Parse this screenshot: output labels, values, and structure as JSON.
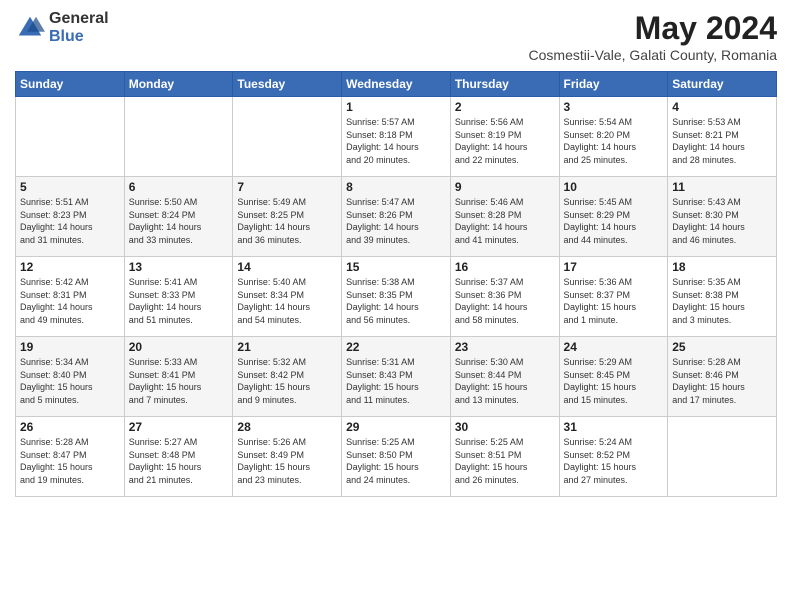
{
  "logo": {
    "general": "General",
    "blue": "Blue"
  },
  "header": {
    "month": "May 2024",
    "location": "Cosmestii-Vale, Galati County, Romania"
  },
  "days_of_week": [
    "Sunday",
    "Monday",
    "Tuesday",
    "Wednesday",
    "Thursday",
    "Friday",
    "Saturday"
  ],
  "weeks": [
    [
      {
        "day": "",
        "info": ""
      },
      {
        "day": "",
        "info": ""
      },
      {
        "day": "",
        "info": ""
      },
      {
        "day": "1",
        "info": "Sunrise: 5:57 AM\nSunset: 8:18 PM\nDaylight: 14 hours\nand 20 minutes."
      },
      {
        "day": "2",
        "info": "Sunrise: 5:56 AM\nSunset: 8:19 PM\nDaylight: 14 hours\nand 22 minutes."
      },
      {
        "day": "3",
        "info": "Sunrise: 5:54 AM\nSunset: 8:20 PM\nDaylight: 14 hours\nand 25 minutes."
      },
      {
        "day": "4",
        "info": "Sunrise: 5:53 AM\nSunset: 8:21 PM\nDaylight: 14 hours\nand 28 minutes."
      }
    ],
    [
      {
        "day": "5",
        "info": "Sunrise: 5:51 AM\nSunset: 8:23 PM\nDaylight: 14 hours\nand 31 minutes."
      },
      {
        "day": "6",
        "info": "Sunrise: 5:50 AM\nSunset: 8:24 PM\nDaylight: 14 hours\nand 33 minutes."
      },
      {
        "day": "7",
        "info": "Sunrise: 5:49 AM\nSunset: 8:25 PM\nDaylight: 14 hours\nand 36 minutes."
      },
      {
        "day": "8",
        "info": "Sunrise: 5:47 AM\nSunset: 8:26 PM\nDaylight: 14 hours\nand 39 minutes."
      },
      {
        "day": "9",
        "info": "Sunrise: 5:46 AM\nSunset: 8:28 PM\nDaylight: 14 hours\nand 41 minutes."
      },
      {
        "day": "10",
        "info": "Sunrise: 5:45 AM\nSunset: 8:29 PM\nDaylight: 14 hours\nand 44 minutes."
      },
      {
        "day": "11",
        "info": "Sunrise: 5:43 AM\nSunset: 8:30 PM\nDaylight: 14 hours\nand 46 minutes."
      }
    ],
    [
      {
        "day": "12",
        "info": "Sunrise: 5:42 AM\nSunset: 8:31 PM\nDaylight: 14 hours\nand 49 minutes."
      },
      {
        "day": "13",
        "info": "Sunrise: 5:41 AM\nSunset: 8:33 PM\nDaylight: 14 hours\nand 51 minutes."
      },
      {
        "day": "14",
        "info": "Sunrise: 5:40 AM\nSunset: 8:34 PM\nDaylight: 14 hours\nand 54 minutes."
      },
      {
        "day": "15",
        "info": "Sunrise: 5:38 AM\nSunset: 8:35 PM\nDaylight: 14 hours\nand 56 minutes."
      },
      {
        "day": "16",
        "info": "Sunrise: 5:37 AM\nSunset: 8:36 PM\nDaylight: 14 hours\nand 58 minutes."
      },
      {
        "day": "17",
        "info": "Sunrise: 5:36 AM\nSunset: 8:37 PM\nDaylight: 15 hours\nand 1 minute."
      },
      {
        "day": "18",
        "info": "Sunrise: 5:35 AM\nSunset: 8:38 PM\nDaylight: 15 hours\nand 3 minutes."
      }
    ],
    [
      {
        "day": "19",
        "info": "Sunrise: 5:34 AM\nSunset: 8:40 PM\nDaylight: 15 hours\nand 5 minutes."
      },
      {
        "day": "20",
        "info": "Sunrise: 5:33 AM\nSunset: 8:41 PM\nDaylight: 15 hours\nand 7 minutes."
      },
      {
        "day": "21",
        "info": "Sunrise: 5:32 AM\nSunset: 8:42 PM\nDaylight: 15 hours\nand 9 minutes."
      },
      {
        "day": "22",
        "info": "Sunrise: 5:31 AM\nSunset: 8:43 PM\nDaylight: 15 hours\nand 11 minutes."
      },
      {
        "day": "23",
        "info": "Sunrise: 5:30 AM\nSunset: 8:44 PM\nDaylight: 15 hours\nand 13 minutes."
      },
      {
        "day": "24",
        "info": "Sunrise: 5:29 AM\nSunset: 8:45 PM\nDaylight: 15 hours\nand 15 minutes."
      },
      {
        "day": "25",
        "info": "Sunrise: 5:28 AM\nSunset: 8:46 PM\nDaylight: 15 hours\nand 17 minutes."
      }
    ],
    [
      {
        "day": "26",
        "info": "Sunrise: 5:28 AM\nSunset: 8:47 PM\nDaylight: 15 hours\nand 19 minutes."
      },
      {
        "day": "27",
        "info": "Sunrise: 5:27 AM\nSunset: 8:48 PM\nDaylight: 15 hours\nand 21 minutes."
      },
      {
        "day": "28",
        "info": "Sunrise: 5:26 AM\nSunset: 8:49 PM\nDaylight: 15 hours\nand 23 minutes."
      },
      {
        "day": "29",
        "info": "Sunrise: 5:25 AM\nSunset: 8:50 PM\nDaylight: 15 hours\nand 24 minutes."
      },
      {
        "day": "30",
        "info": "Sunrise: 5:25 AM\nSunset: 8:51 PM\nDaylight: 15 hours\nand 26 minutes."
      },
      {
        "day": "31",
        "info": "Sunrise: 5:24 AM\nSunset: 8:52 PM\nDaylight: 15 hours\nand 27 minutes."
      },
      {
        "day": "",
        "info": ""
      }
    ]
  ]
}
